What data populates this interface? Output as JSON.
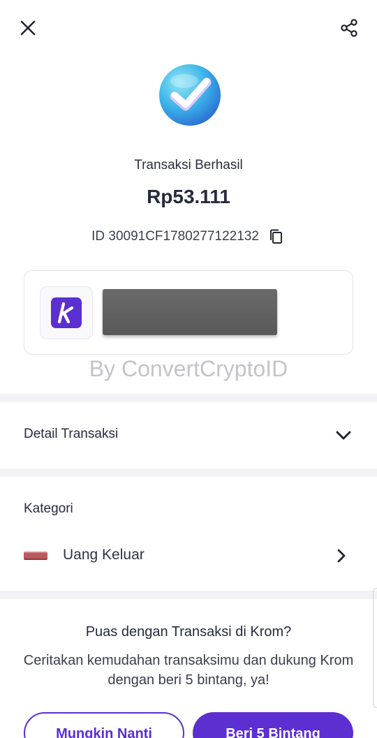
{
  "header": {
    "close_icon": "close-icon",
    "share_icon": "share-icon"
  },
  "status": {
    "icon": "check-badge-icon",
    "title": "Transaksi Berhasil",
    "amount": "Rp53.111",
    "transaction_id": "ID 30091CF1780277122132",
    "copy_icon": "copy-icon"
  },
  "merchant": {
    "logo_letter": "k",
    "logo_color": "#5b2fd0",
    "name_redacted": true
  },
  "watermark": "By ConvertCryptoID",
  "detail": {
    "label": "Detail Transaksi",
    "icon": "chevron-down-icon"
  },
  "category": {
    "heading": "Kategori",
    "item_label": "Uang Keluar",
    "item_color": "#b85a5e",
    "icon": "chevron-right-icon"
  },
  "rating": {
    "title": "Puas dengan Transaksi di Krom?",
    "description": "Ceritakan kemudahan transaksimu dan dukung Krom dengan beri 5 bintang, ya!",
    "later_label": "Mungkin Nanti",
    "rate_label": "Beri 5 Bintang"
  },
  "colors": {
    "accent": "#5b2fd0",
    "text": "#262a3d",
    "divider": "#f3f3f5"
  }
}
